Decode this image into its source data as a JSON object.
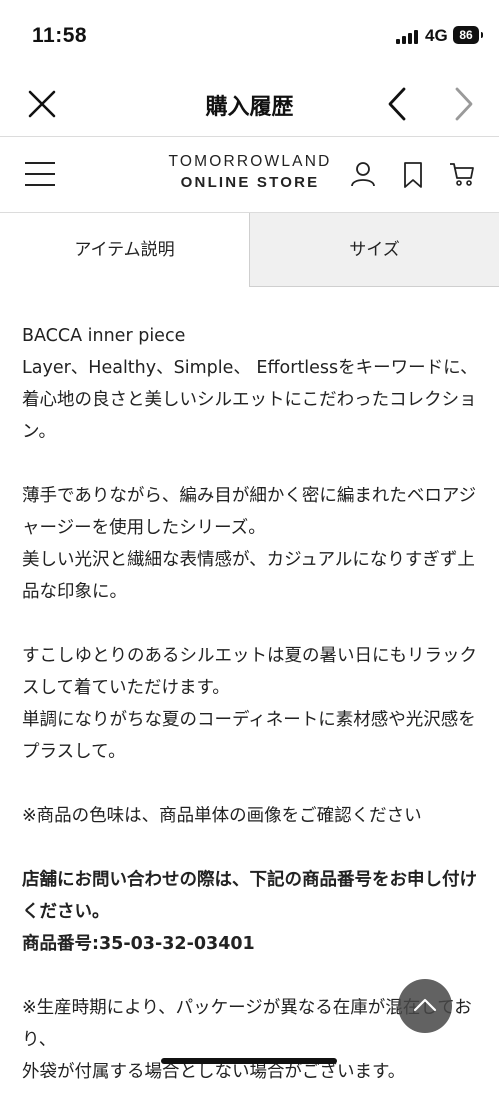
{
  "status_bar": {
    "time": "11:58",
    "network": "4G",
    "battery": "86"
  },
  "nav": {
    "title": "購入履歴"
  },
  "header": {
    "logo_line1": "TOMORROWLAND",
    "logo_line2": "ONLINE STORE"
  },
  "tabs": [
    {
      "label": "アイテム説明",
      "active": true
    },
    {
      "label": "サイズ",
      "active": false
    }
  ],
  "content": {
    "paragraphs": [
      {
        "text": "BACCA inner piece\nLayer、Healthy、Simple、 Effortlessをキーワードに、着心地の良さと美しいシルエットにこだわったコレクション。",
        "bold": false
      },
      {
        "text": "薄手でありながら、編み目が細かく密に編まれたベロアジャージーを使用したシリーズ。\n美しい光沢と繊細な表情感が、カジュアルになりすぎず上品な印象に。",
        "bold": false
      },
      {
        "text": "すこしゆとりのあるシルエットは夏の暑い日にもリラックスして着ていただけます。\n単調になりがちな夏のコーディネートに素材感や光沢感をプラスして。",
        "bold": false
      },
      {
        "text": "※商品の色味は、商品単体の画像をご確認ください",
        "bold": false
      },
      {
        "text": "店舗にお問い合わせの際は、下記の商品番号をお申し付けください。\n商品番号:35-03-32-03401",
        "bold": true
      },
      {
        "text": "※生産時期により、パッケージが異なる在庫が混在しており、\n外袋が付属する場合としない場合がございます。",
        "bold": false
      }
    ]
  },
  "colors": {
    "text": "#222222",
    "divider": "#dcdcdc",
    "inactive_tab_bg": "#f0f0f0"
  }
}
